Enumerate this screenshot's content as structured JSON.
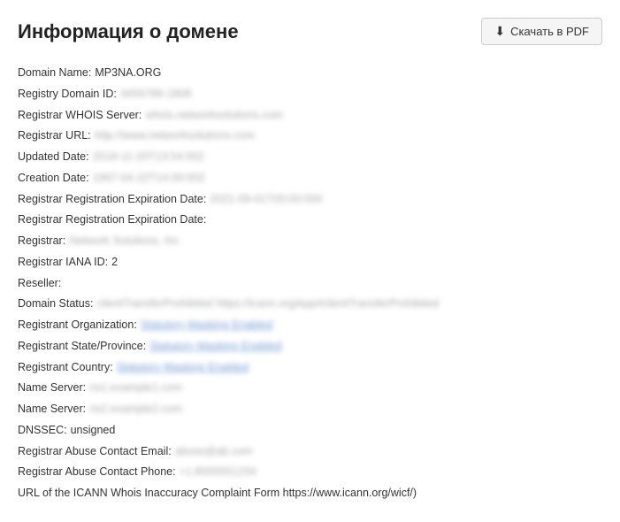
{
  "header": {
    "title": "Информация о домене",
    "download_button": "Скачать в PDF"
  },
  "fields": [
    {
      "label": "Domain Name:",
      "value": "MP3NA.ORG",
      "type": "plain"
    },
    {
      "label": "Registry Domain ID:",
      "value": "3456789-1808",
      "type": "blurred"
    },
    {
      "label": "Registrar WHOIS Server:",
      "value": "whois.networksolutions.com",
      "type": "blurred"
    },
    {
      "label": "Registrar URL:",
      "value": "http://www.networksolutions.com",
      "type": "blurred"
    },
    {
      "label": "Updated Date:",
      "value": "2018-11-20T13:54:002",
      "type": "blurred"
    },
    {
      "label": "Creation Date:",
      "value": "1997-04-22T14:00:002",
      "type": "blurred"
    },
    {
      "label": "Registrar Registration Expiration Date:",
      "value": "2021-09-01T00:00:000",
      "type": "blurred"
    },
    {
      "label": "Registrar Registration Expiration Date:",
      "value": "",
      "type": "plain"
    },
    {
      "label": "Registrar:",
      "value": "Network Solutions, Inc",
      "type": "blurred"
    },
    {
      "label": "Registrar IANA ID:",
      "value": "2",
      "type": "plain"
    },
    {
      "label": "Reseller:",
      "value": "",
      "type": "plain"
    },
    {
      "label": "Domain Status:",
      "value": "clientTransferProhibited https://icann.org/epp#clientTransferProhibited",
      "type": "blurred"
    },
    {
      "label": "Registrant Organization:",
      "value": "Statutory Masking Enabled",
      "type": "link-blurred"
    },
    {
      "label": "Registrant State/Province:",
      "value": "Statutory Masking Enabled",
      "type": "link-blurred"
    },
    {
      "label": "Registrant Country:",
      "value": "Statutory Masking Enabled",
      "type": "link-blurred"
    },
    {
      "label": "Name Server:",
      "value": "ns1.example1.com",
      "type": "blurred"
    },
    {
      "label": "Name Server:",
      "value": "ns2.example2.com",
      "type": "blurred"
    },
    {
      "label": "DNSSEC:",
      "value": "unsigned",
      "type": "plain"
    },
    {
      "label": "Registrar Abuse Contact Email:",
      "value": "abuse@ab.com",
      "type": "blurred"
    },
    {
      "label": "Registrar Abuse Contact Phone:",
      "value": "+1.8005551234",
      "type": "blurred"
    },
    {
      "label": "URL of the ICANN Whois Inaccuracy Complaint Form https://www.icann.org/wicf/)",
      "value": "",
      "type": "plain"
    }
  ]
}
